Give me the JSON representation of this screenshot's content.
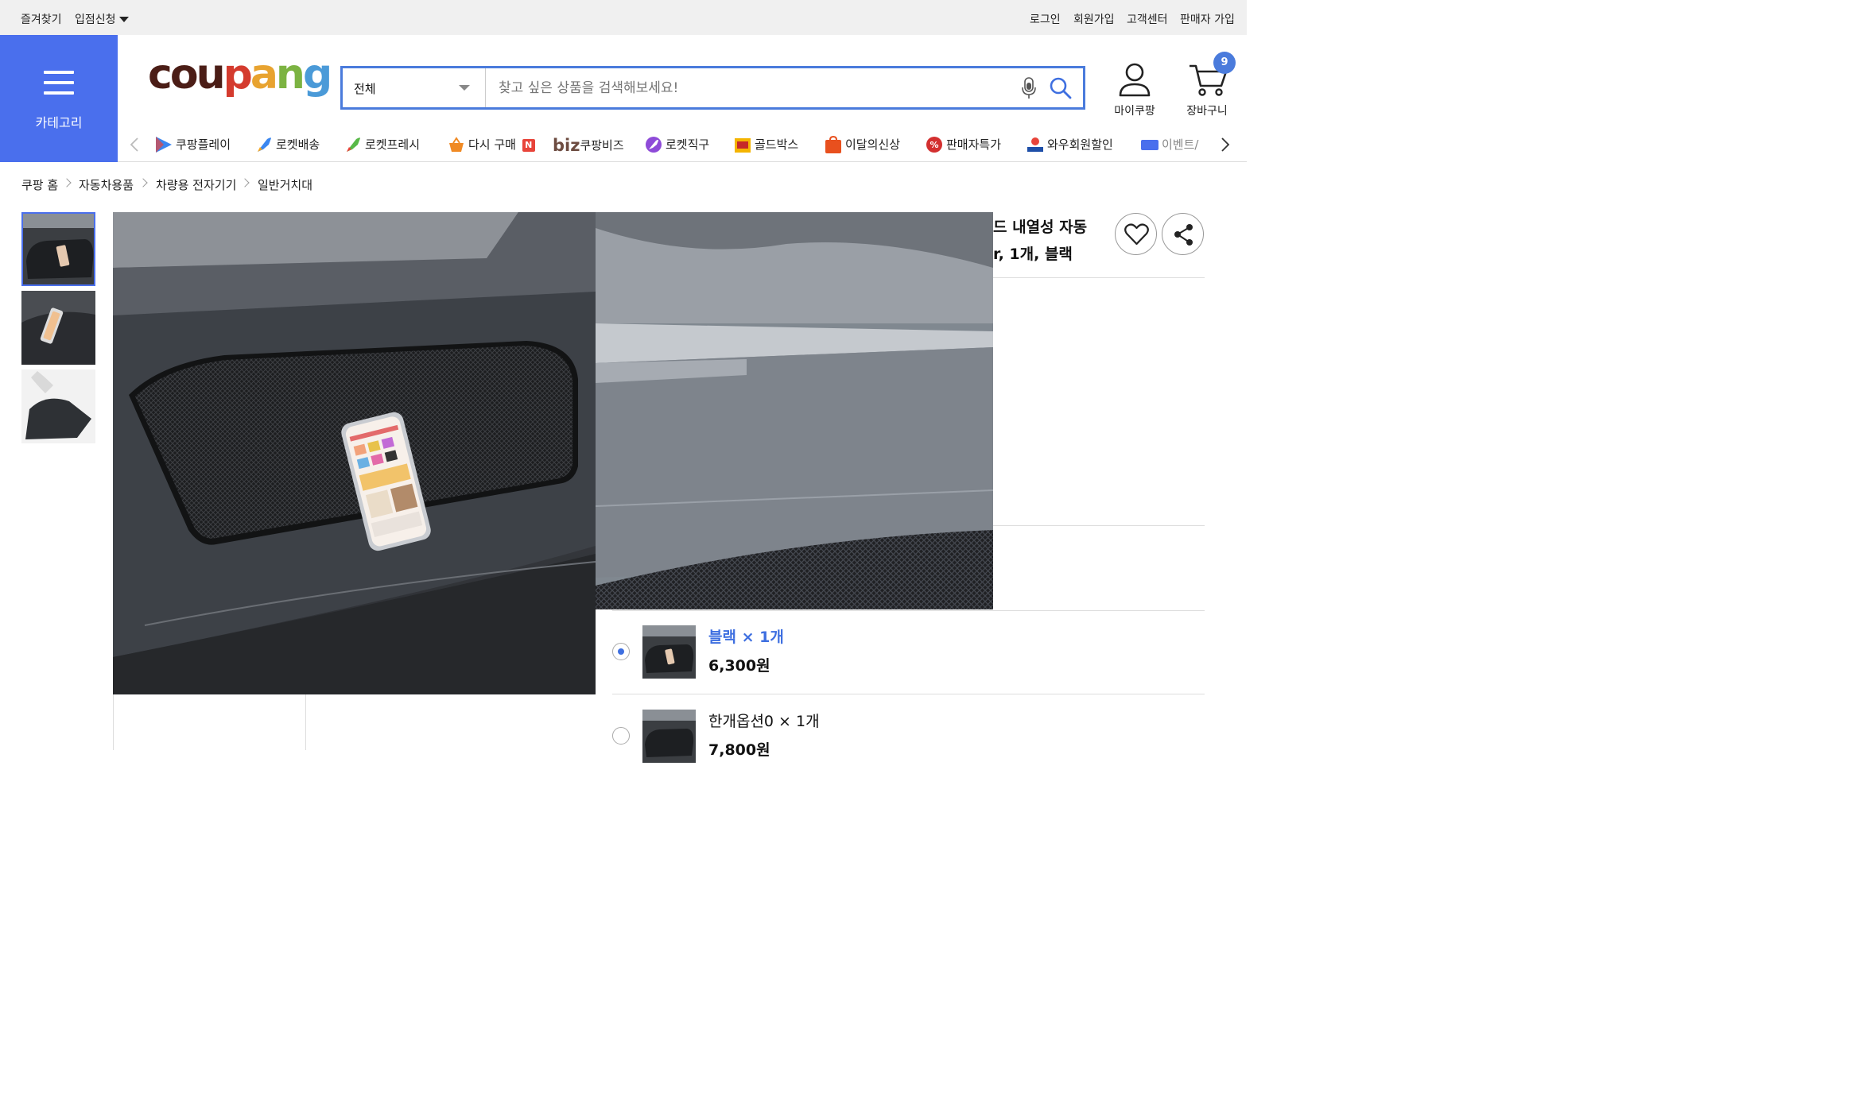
{
  "topbar": {
    "bookmark": "즐겨찾기",
    "partner": "입점신청",
    "login": "로그인",
    "signup": "회원가입",
    "support": "고객센터",
    "seller_signup": "판매자 가입"
  },
  "header": {
    "category_label": "카테고리",
    "logo": {
      "c": "c",
      "o": "o",
      "u": "u",
      "p": "p",
      "a": "a",
      "n": "n",
      "g": "g"
    },
    "search": {
      "scope": "전체",
      "placeholder": "찾고 싶은 상품을 검색해보세요!"
    },
    "mycoupang": "마이쿠팡",
    "cart": "장바구니",
    "cart_count": "9"
  },
  "nav": {
    "items": [
      {
        "label": "쿠팡플레이"
      },
      {
        "label": "로켓배송"
      },
      {
        "label": "로켓프레시"
      },
      {
        "label": "다시 구매"
      },
      {
        "label": "쿠팡비즈",
        "prefix": "biz"
      },
      {
        "label": "로켓직구"
      },
      {
        "label": "골드박스"
      },
      {
        "label": "이달의신상"
      },
      {
        "label": "판매자특가"
      },
      {
        "label": "와우회원할인"
      },
      {
        "label": "이벤트/"
      }
    ],
    "new_badge": "N"
  },
  "breadcrumb": [
    "쿠팡 홈",
    "자동차용품",
    "차량용 전자기기",
    "일반거치대"
  ],
  "product": {
    "title_line1": "드 내열성 자동",
    "title_line2": "r, 1개, 블랙"
  },
  "options": [
    {
      "name": "블랙 × 1개",
      "price": "6,300원",
      "selected": true
    },
    {
      "name": "한개옵션0 × 1개",
      "price": "7,800원",
      "selected": false
    }
  ],
  "colors": {
    "accent": "#4a6fed",
    "search_border": "#4a7bdc",
    "selected_option": "#3e6fe0"
  }
}
